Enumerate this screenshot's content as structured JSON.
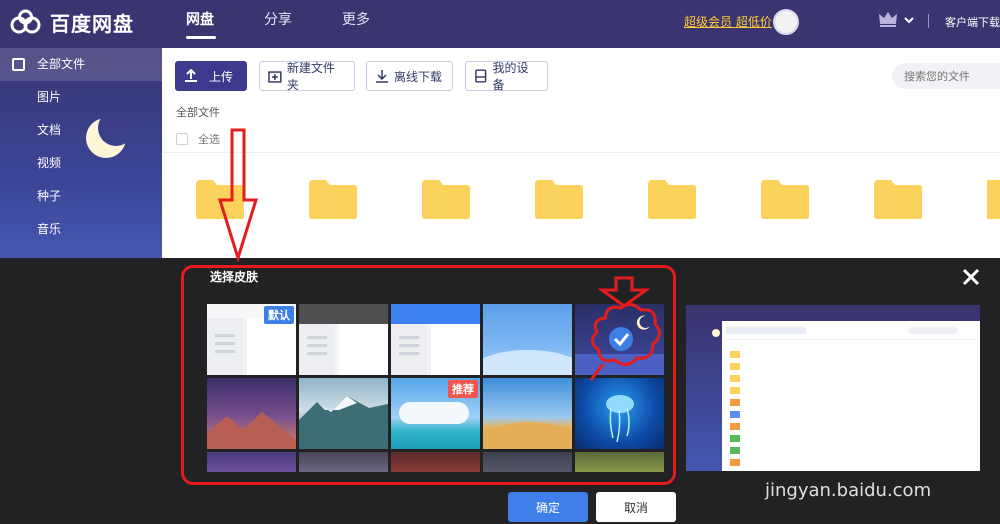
{
  "app": {
    "name": "百度网盘"
  },
  "header": {
    "nav": [
      {
        "label": "网盘",
        "active": true
      },
      {
        "label": "分享",
        "active": false
      },
      {
        "label": "更多",
        "active": false
      }
    ],
    "vip_text": "超级会员 超低价",
    "client_download": "客户端下载"
  },
  "sidebar": {
    "items": [
      {
        "label": "全部文件",
        "active": true
      },
      {
        "label": "图片",
        "active": false
      },
      {
        "label": "文档",
        "active": false
      },
      {
        "label": "视频",
        "active": false
      },
      {
        "label": "种子",
        "active": false
      },
      {
        "label": "音乐",
        "active": false
      }
    ]
  },
  "toolbar": {
    "upload": "上传",
    "new_folder": "新建文件夹",
    "offline_download": "离线下载",
    "my_devices": "我的设备",
    "search_placeholder": "搜索您的文件"
  },
  "main": {
    "breadcrumb": "全部文件",
    "select_all": "全选"
  },
  "skin_panel": {
    "title": "选择皮肤",
    "badges": {
      "default": "默认",
      "recommended": "推荐"
    },
    "confirm": "确定",
    "cancel": "取消"
  },
  "watermark": {
    "line": "jingyan.baidu.com"
  },
  "colors": {
    "header_bg": "#3a3470",
    "vip": "#ffcc33",
    "folder": "#fbd35c",
    "confirm_btn": "#3f7ee8",
    "annotation_red": "#e41c1c"
  }
}
